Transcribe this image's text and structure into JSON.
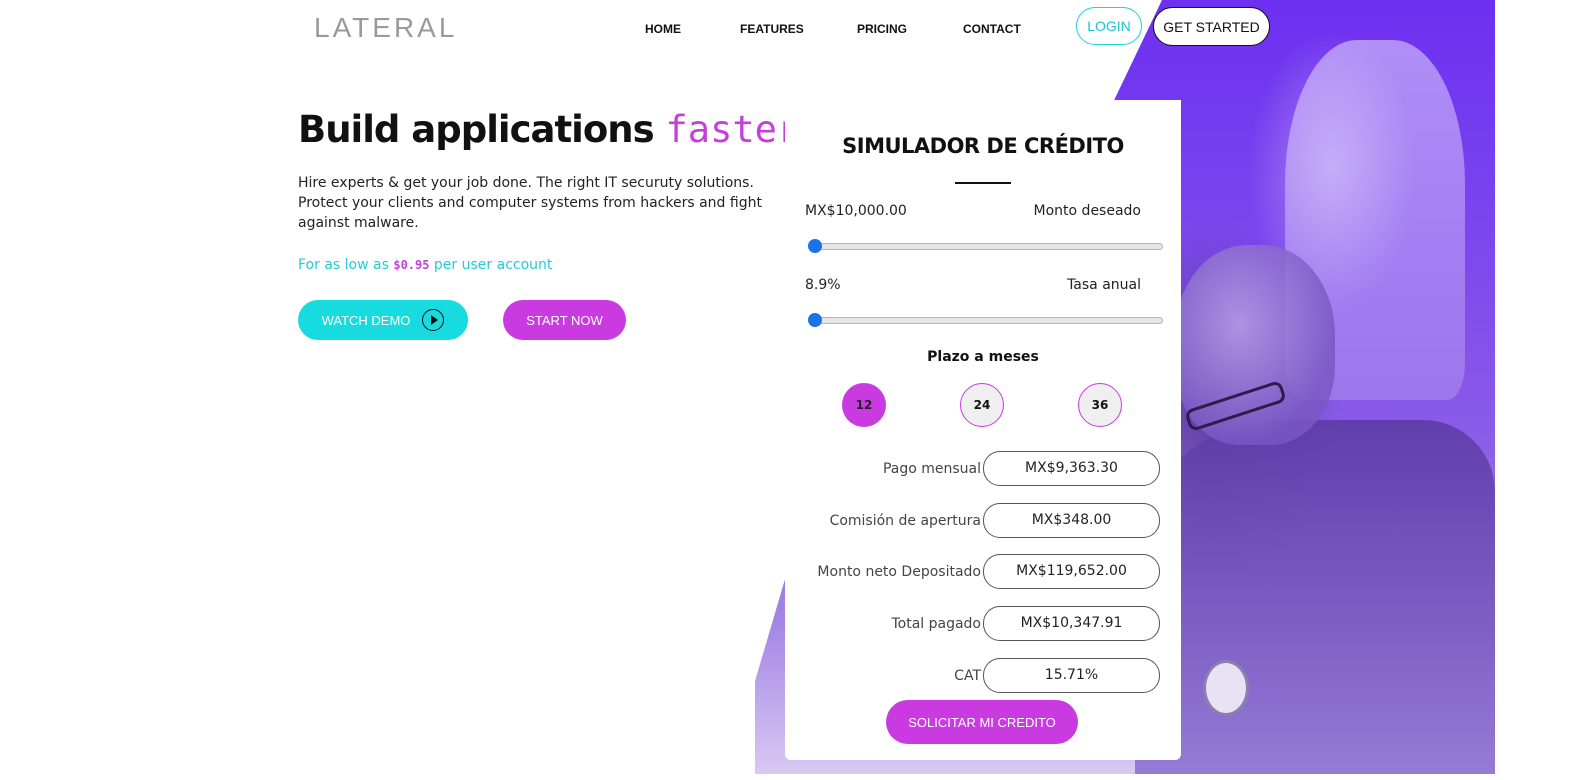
{
  "brand": {
    "logo": "LATERAL"
  },
  "nav": {
    "items": [
      "HOME",
      "FEATURES",
      "PRICING",
      "CONTACT"
    ],
    "login": "LOGIN",
    "get_started": "GET STARTED"
  },
  "hero": {
    "title_main": "Build applications",
    "title_accent": "faster",
    "description": "Hire experts & get your job done. The right IT securuty solutions. Protect your clients and computer systems from hackers and fight against malware.",
    "price_prefix": "For as low as",
    "price_value": "$0.95",
    "price_suffix": "per user account",
    "watch_demo": "WATCH DEMO",
    "start_now": "START NOW"
  },
  "simulator": {
    "title": "SIMULADOR DE CRÉDITO",
    "amount": {
      "value": "MX$10,000.00",
      "label": "Monto deseado",
      "slider_fraction": 0
    },
    "rate": {
      "value": "8.9%",
      "label": "Tasa anual",
      "slider_fraction": 0
    },
    "term_title": "Plazo a meses",
    "terms": [
      "12",
      "24",
      "36"
    ],
    "selected_term": "12",
    "results": [
      {
        "label": "Pago mensual",
        "value": "MX$9,363.30"
      },
      {
        "label": "Comisión de apertura",
        "value": "MX$348.00"
      },
      {
        "label": "Monto neto Depositado",
        "value": "MX$119,652.00"
      },
      {
        "label": "Total pagado",
        "value": "MX$10,347.91"
      },
      {
        "label": "CAT",
        "value": "15.71%"
      }
    ],
    "submit": "SOLICITAR MI CREDITO"
  },
  "colors": {
    "accent_purple": "#c93ae0",
    "accent_cyan": "#17dbdf",
    "slider_blue": "#1a73e8"
  },
  "icons": {
    "play": "play-circle-icon"
  }
}
